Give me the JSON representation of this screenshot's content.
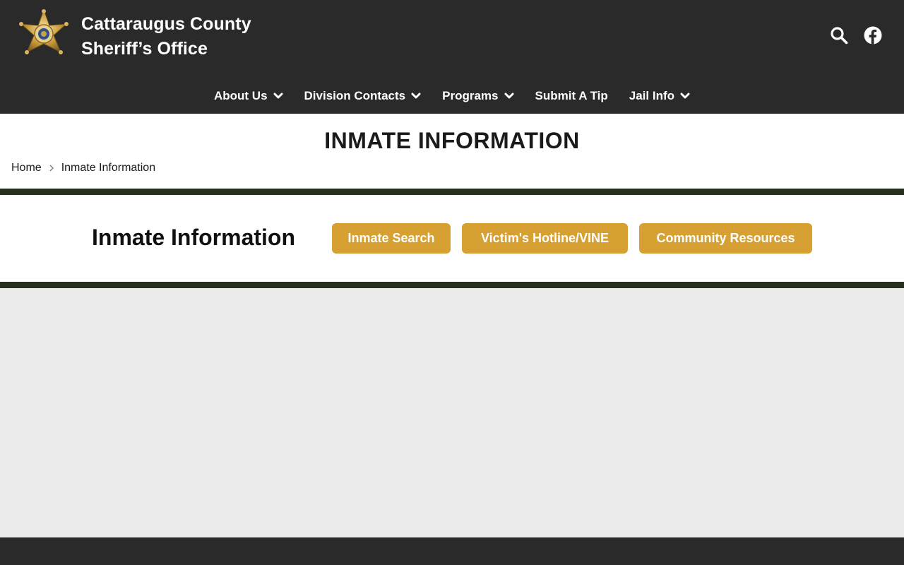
{
  "header": {
    "title_line1": "Cattaraugus County",
    "title_line2": "Sheriff’s Office",
    "icons": [
      "star-badge-logo",
      "search-icon",
      "facebook-icon"
    ]
  },
  "nav": {
    "items": [
      {
        "label": "About Us",
        "has_dropdown": true
      },
      {
        "label": "Division Contacts",
        "has_dropdown": true
      },
      {
        "label": "Programs",
        "has_dropdown": true
      },
      {
        "label": "Submit A Tip",
        "has_dropdown": false
      },
      {
        "label": "Jail Info",
        "has_dropdown": true
      }
    ]
  },
  "page": {
    "title": "INMATE INFORMATION",
    "breadcrumb": [
      "Home",
      "Inmate Information"
    ]
  },
  "section": {
    "heading": "Inmate Information",
    "buttons": [
      "Inmate Search",
      "Victim's Hotline/VINE",
      "Community Resources"
    ]
  },
  "colors": {
    "header_bg": "#2a2a2a",
    "band": "#25301e",
    "accent_gold": "#d6a032",
    "page_bg": "#ececec"
  }
}
